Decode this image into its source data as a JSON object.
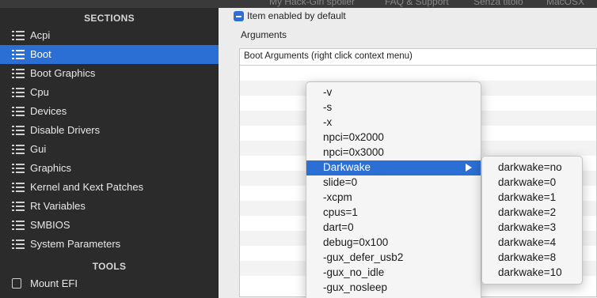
{
  "window": {
    "title_fragments": [
      "My Hack-Girl spoiler",
      "FAQ & Support",
      "Senza titolo",
      "MacOSX"
    ]
  },
  "sidebar": {
    "sections_header": "SECTIONS",
    "items": [
      {
        "label": "Acpi",
        "selected": false
      },
      {
        "label": "Boot",
        "selected": true
      },
      {
        "label": "Boot Graphics",
        "selected": false
      },
      {
        "label": "Cpu",
        "selected": false
      },
      {
        "label": "Devices",
        "selected": false
      },
      {
        "label": "Disable Drivers",
        "selected": false
      },
      {
        "label": "Gui",
        "selected": false
      },
      {
        "label": "Graphics",
        "selected": false
      },
      {
        "label": "Kernel and Kext Patches",
        "selected": false
      },
      {
        "label": "Rt Variables",
        "selected": false
      },
      {
        "label": "SMBIOS",
        "selected": false
      },
      {
        "label": "System Parameters",
        "selected": false
      }
    ],
    "tools_header": "TOOLS",
    "tools": [
      {
        "label": "Mount EFI"
      }
    ]
  },
  "main": {
    "checkbox_label": "Item enabled by default",
    "checkbox_checked": true,
    "arguments_title": "Arguments",
    "table_header": "Boot Arguments (right click context menu)"
  },
  "context_menu": {
    "items": [
      {
        "label": "-v"
      },
      {
        "label": "-s"
      },
      {
        "label": "-x"
      },
      {
        "label": "npci=0x2000"
      },
      {
        "label": "npci=0x3000"
      },
      {
        "label": "Darkwake",
        "highlighted": true,
        "has_submenu": true
      },
      {
        "label": "slide=0"
      },
      {
        "label": "-xcpm"
      },
      {
        "label": "cpus=1"
      },
      {
        "label": "dart=0"
      },
      {
        "label": "debug=0x100"
      },
      {
        "label": "-gux_defer_usb2"
      },
      {
        "label": "-gux_no_idle"
      },
      {
        "label": "-gux_nosleep"
      }
    ],
    "submenu": [
      {
        "label": "darkwake=no"
      },
      {
        "label": "darkwake=0"
      },
      {
        "label": "darkwake=1"
      },
      {
        "label": "darkwake=2"
      },
      {
        "label": "darkwake=3"
      },
      {
        "label": "darkwake=4"
      },
      {
        "label": "darkwake=8"
      },
      {
        "label": "darkwake=10"
      }
    ]
  },
  "colors": {
    "accent": "#2c6fd4",
    "sidebar_bg": "#2b2b2b",
    "panel_bg": "#ececec"
  },
  "icons": {
    "sidebar_item": "list-icon",
    "mount_efi": "drive-icon",
    "submenu_arrow": "chevron-right-icon"
  }
}
